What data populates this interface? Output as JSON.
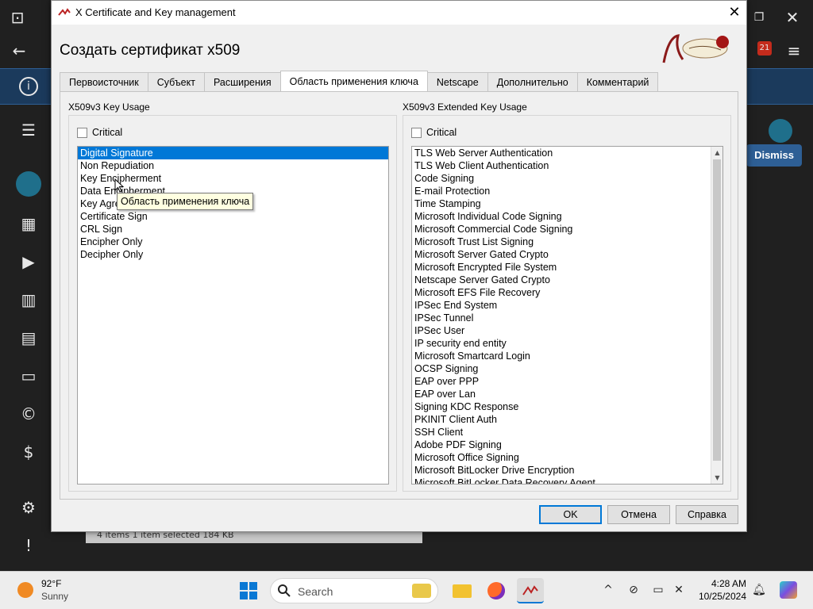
{
  "window": {
    "title": "X Certificate and Key management",
    "heading": "Создать сертификат x509"
  },
  "tabs": [
    {
      "label": "Первоисточник"
    },
    {
      "label": "Субъект"
    },
    {
      "label": "Расширения"
    },
    {
      "label": "Область применения ключа",
      "active": true
    },
    {
      "label": "Netscape"
    },
    {
      "label": "Дополнительно"
    },
    {
      "label": "Комментарий"
    }
  ],
  "key_usage": {
    "title": "X509v3 Key Usage",
    "critical_label": "Critical",
    "items": [
      "Digital Signature",
      "Non Repudiation",
      "Key Encipherment",
      "Data Encipherment",
      "Key Agreement",
      "Certificate Sign",
      "CRL Sign",
      "Encipher Only",
      "Decipher Only"
    ],
    "selected": "Digital Signature"
  },
  "extended_key_usage": {
    "title": "X509v3 Extended Key Usage",
    "critical_label": "Critical",
    "items": [
      "TLS Web Server Authentication",
      "TLS Web Client Authentication",
      "Code Signing",
      "E-mail Protection",
      "Time Stamping",
      "Microsoft Individual Code Signing",
      "Microsoft Commercial Code Signing",
      "Microsoft Trust List Signing",
      "Microsoft Server Gated Crypto",
      "Microsoft Encrypted File System",
      "Netscape Server Gated Crypto",
      "Microsoft EFS File Recovery",
      "IPSec End System",
      "IPSec Tunnel",
      "IPSec User",
      "IP security end entity",
      "Microsoft Smartcard Login",
      "OCSP Signing",
      "EAP over PPP",
      "EAP over Lan",
      "Signing KDC Response",
      "PKINIT Client Auth",
      "SSH Client",
      "Adobe PDF Signing",
      "Microsoft Office Signing",
      "Microsoft BitLocker Drive Encryption",
      "Microsoft BitLocker Data Recovery Agent"
    ]
  },
  "tooltip": "Область применения ключа",
  "buttons": {
    "ok": "OK",
    "cancel": "Отмена",
    "help": "Справка"
  },
  "background": {
    "dismiss_label": "Dismiss",
    "badge": "21",
    "status": "4 items     1 item selected  184 KB"
  },
  "taskbar": {
    "weather_temp": "92°F",
    "weather_desc": "Sunny",
    "search_label": "Search",
    "time": "4:28 AM",
    "date": "10/25/2024"
  },
  "colors": {
    "selection": "#0078d7",
    "tooltip_bg": "#ffffe1"
  }
}
